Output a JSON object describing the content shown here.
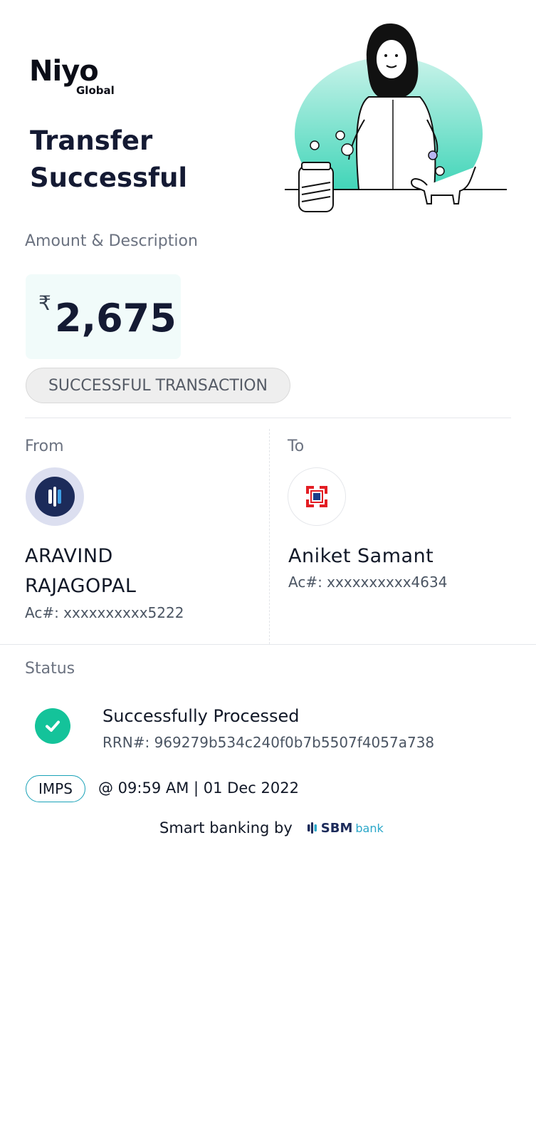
{
  "brand": {
    "name": "Niyo",
    "sub": "Global"
  },
  "header": {
    "title_line1": "Transfer",
    "title_line2": "Successful"
  },
  "amount_section": {
    "label": "Amount & Description",
    "currency_symbol": "₹",
    "amount": "2,675",
    "status_pill": "SUCCESSFUL TRANSACTION"
  },
  "from": {
    "label": "From",
    "name_line1": "ARAVIND",
    "name_line2": "RAJAGOPAL",
    "account": "Ac#: xxxxxxxxxx5222"
  },
  "to": {
    "label": "To",
    "name": "Aniket Samant",
    "account": "Ac#: xxxxxxxxxx4634"
  },
  "status": {
    "label": "Status",
    "title": "Successfully Processed",
    "rrn": "RRN#: 969279b534c240f0b7b5507f4057a738"
  },
  "transfer_mode": {
    "mode": "IMPS",
    "timestamp": "@ 09:59 AM | 01 Dec 2022"
  },
  "footer": {
    "text": "Smart banking by",
    "bank_name": "SBM",
    "bank_suffix": "bank"
  },
  "colors": {
    "accent_teal": "#14c39a",
    "brand_navy": "#141a33",
    "imps_border": "#1aa2b8",
    "hdfc_red": "#e31e24",
    "hdfc_blue": "#1a3e8c"
  },
  "icons": {
    "status": "check-circle-icon",
    "from_bank": "bank-logo-icon",
    "to_bank": "hdfc-logo-icon"
  }
}
